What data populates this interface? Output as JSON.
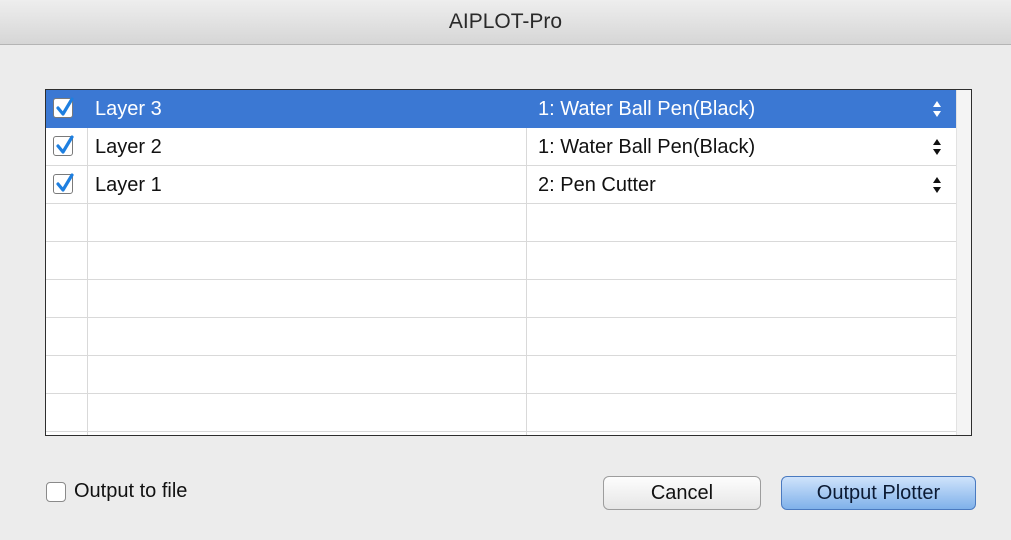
{
  "window": {
    "title": "AIPLOT-Pro"
  },
  "layers": [
    {
      "checked": true,
      "name": "Layer 3",
      "tool": "1: Water Ball Pen(Black)",
      "selected": true
    },
    {
      "checked": true,
      "name": "Layer 2",
      "tool": "1: Water Ball Pen(Black)",
      "selected": false
    },
    {
      "checked": true,
      "name": "Layer 1",
      "tool": "2: Pen Cutter",
      "selected": false
    }
  ],
  "footer": {
    "output_to_file_label": "Output to file",
    "output_to_file_checked": false,
    "cancel_label": "Cancel",
    "output_plotter_label": "Output Plotter"
  },
  "colors": {
    "selection": "#3b78d3",
    "checkbox_fill": "#1e7fe0",
    "default_button": "#7fb1ea"
  },
  "icons": {
    "checkbox": "checkmark-icon",
    "stepper": "up-down-arrows-icon"
  }
}
